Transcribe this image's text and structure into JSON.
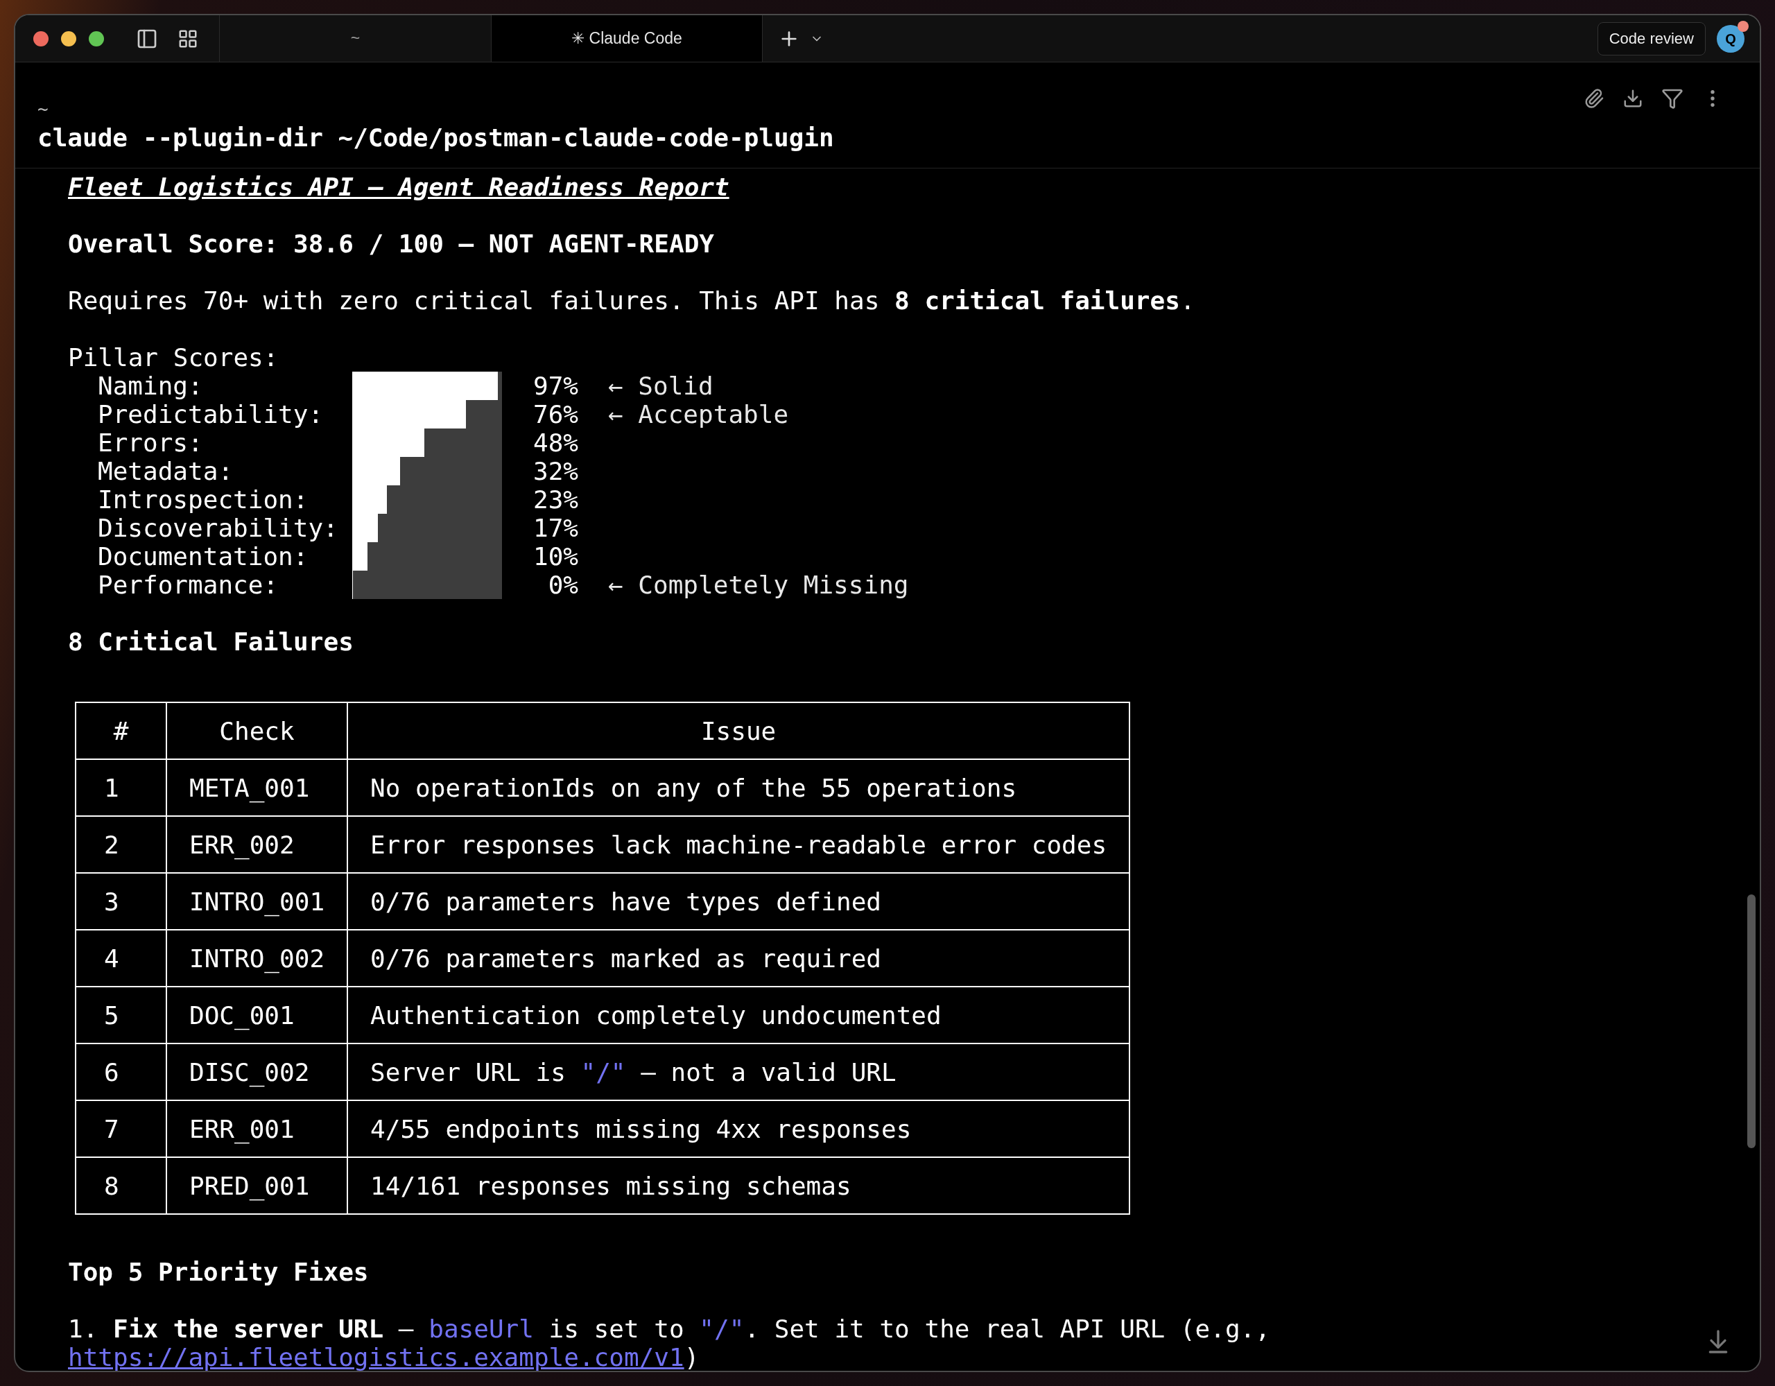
{
  "window": {
    "tabs": [
      {
        "label": "~",
        "selected": false
      },
      {
        "label": "✳ Claude Code",
        "selected": true
      }
    ],
    "review_button": "Code review",
    "avatar": {
      "initial": "Q",
      "notification": true
    }
  },
  "terminal": {
    "directory": "~",
    "command": "claude --plugin-dir ~/Code/postman-claude-code-plugin"
  },
  "report": {
    "title": "Fleet Logistics API — Agent Readiness Report",
    "overall": "Overall Score: 38.6 / 100 — NOT AGENT-READY",
    "requirement": "Requires 70+ with zero critical failures. This API has **8 critical failures**.",
    "pillars_heading": "Pillar Scores:",
    "pillars": [
      {
        "name": "Naming:",
        "level": 0.97,
        "percent": "97%",
        "note": "← Solid"
      },
      {
        "name": "Predictability:",
        "level": 0.76,
        "percent": "76%",
        "note": "← Acceptable"
      },
      {
        "name": "Errors:",
        "level": 0.48,
        "percent": "48%"
      },
      {
        "name": "Metadata:",
        "level": 0.32,
        "percent": "32%"
      },
      {
        "name": "Introspection:",
        "level": 0.23,
        "percent": "23%"
      },
      {
        "name": "Discoverability:",
        "level": 0.17,
        "percent": "17%"
      },
      {
        "name": "Documentation:",
        "level": 0.1,
        "percent": "10%"
      },
      {
        "name": "Performance:",
        "level": 0,
        "percent": "0%",
        "note": "← Completely Missing"
      }
    ],
    "failures_heading": "8 Critical Failures",
    "table": {
      "columns": [
        "#",
        "Check",
        "Issue"
      ],
      "rows": [
        {
          "num": "1",
          "check": "META_001",
          "issue": [
            {
              "kind": "plain",
              "text": "No operationIds on any of the 55 operations"
            }
          ]
        },
        {
          "num": "2",
          "check": "ERR_002",
          "issue": [
            {
              "kind": "plain",
              "text": "Error responses lack machine-readable error codes"
            }
          ]
        },
        {
          "num": "3",
          "check": "INTRO_001",
          "issue": [
            {
              "kind": "plain",
              "text": "0/76 parameters have types defined"
            }
          ]
        },
        {
          "num": "4",
          "check": "INTRO_002",
          "issue": [
            {
              "kind": "plain",
              "text": "0/76 parameters marked as required"
            }
          ]
        },
        {
          "num": "5",
          "check": "DOC_001",
          "issue": [
            {
              "kind": "plain",
              "text": "Authentication completely undocumented"
            }
          ]
        },
        {
          "num": "6",
          "check": "DISC_002",
          "issue": [
            {
              "kind": "plain",
              "text": "Server URL is "
            },
            {
              "kind": "code",
              "text": "\"/\""
            },
            {
              "kind": "plain",
              "text": " — not a valid URL"
            }
          ]
        },
        {
          "num": "7",
          "check": "ERR_001",
          "issue": [
            {
              "kind": "plain",
              "text": "4/55 endpoints missing 4xx responses"
            }
          ]
        },
        {
          "num": "8",
          "check": "PRED_001",
          "issue": [
            {
              "kind": "plain",
              "text": "14/161 responses missing schemas"
            }
          ]
        }
      ]
    },
    "fixes_heading": "Top 5 Priority Fixes",
    "fixes": [
      {
        "lines": [
          [
            {
              "kind": "plain",
              "text": "1. "
            },
            {
              "kind": "bold",
              "text": "Fix the server URL"
            },
            {
              "kind": "plain",
              "text": " — "
            },
            {
              "kind": "code",
              "text": "baseUrl"
            },
            {
              "kind": "plain",
              "text": " is set to "
            },
            {
              "kind": "code",
              "text": "\"/\""
            },
            {
              "kind": "plain",
              "text": ". Set it to the real API URL (e.g.,"
            }
          ],
          [
            {
              "kind": "link",
              "text": "https://api.fleetlogistics.example.com/v1"
            },
            {
              "kind": "plain",
              "text": ")"
            }
          ]
        ]
      }
    ]
  }
}
